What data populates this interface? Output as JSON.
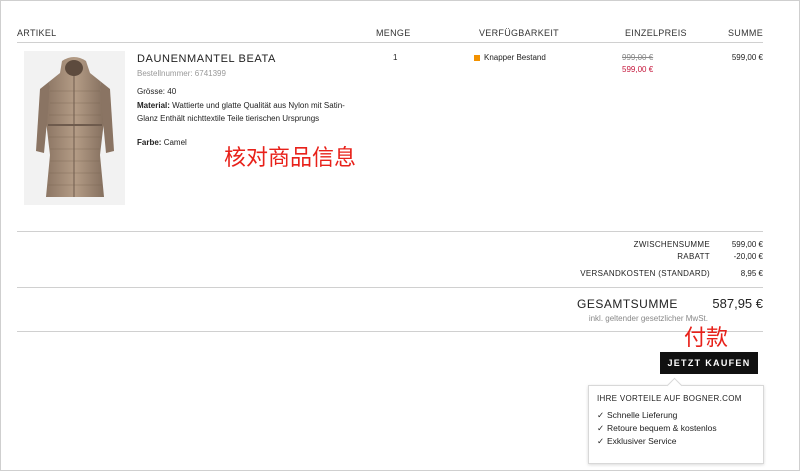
{
  "table": {
    "headers": {
      "article": "ARTIKEL",
      "qty": "MENGE",
      "availability": "VERFÜGBARKEIT",
      "unit_price": "EINZELPREIS",
      "total": "SUMME"
    }
  },
  "product": {
    "name": "DAUNENMANTEL BEATA",
    "order_number": "Bestellnummer: 6741399",
    "size_label": "Grösse:",
    "size_value": "40",
    "material_label": "Material:",
    "material_value": "Wattierte und glatte Qualität aus Nylon mit Satin-Glanz Enthält nichttextile Teile tierischen Ursprungs",
    "color_label": "Farbe:",
    "color_value": "Camel",
    "quantity": "1",
    "availability": "Knapper Bestand",
    "availability_color": "#f39200",
    "price_old": "999,00 €",
    "price_new": "599,00 €",
    "price_new_color": "#c5163b",
    "line_total": "599,00 €"
  },
  "annotations": {
    "verify_info": "核对商品信息",
    "pay": "付款",
    "color": "#e8211a"
  },
  "summary": {
    "subtotal_label": "ZWISCHENSUMME",
    "subtotal_value": "599,00 €",
    "discount_label": "RABATT",
    "discount_value": "-20,00 €",
    "shipping_label": "VERSANDKOSTEN (STANDARD)",
    "shipping_value": "8,95 €",
    "total_label": "GESAMTSUMME",
    "total_value": "587,95 €",
    "vat_note": "inkl. geltender gesetzlicher MwSt."
  },
  "checkout": {
    "buy_label": "JETZT KAUFEN"
  },
  "benefits": {
    "title": "IHRE VORTEILE AUF BOGNER.COM",
    "items": [
      "Schnelle Lieferung",
      "Retoure bequem & kostenlos",
      "Exklusiver Service"
    ]
  }
}
